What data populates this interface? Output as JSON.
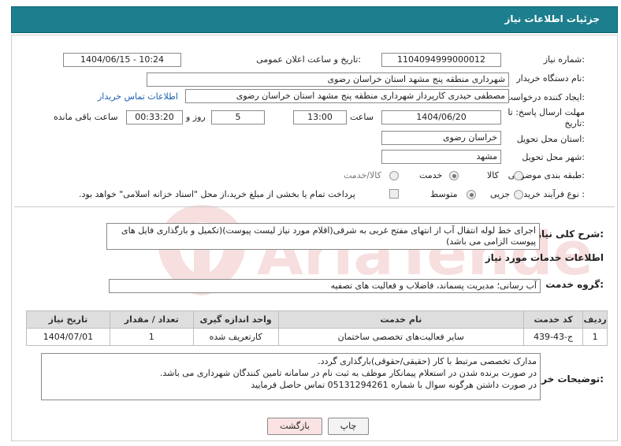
{
  "header": {
    "title": "جزئیات اطلاعات نیاز"
  },
  "form": {
    "need_number": {
      "label": "شماره نیاز:",
      "value": "1104094999000012"
    },
    "announce_datetime": {
      "label": "تاریخ و ساعت اعلان عمومی:",
      "value": "1404/06/15 - 10:24"
    },
    "buyer_org": {
      "label": "نام دستگاه خریدار:",
      "value": "شهرداری منطقه پنج مشهد استان خراسان رضوی"
    },
    "requester": {
      "label": "ایجاد کننده درخواست:",
      "value": "مصطفی حیدری کارپرداز شهرداری منطقه پنج مشهد استان خراسان رضوی",
      "contact_link": "اطلاعات تماس خریدار"
    },
    "deadline": {
      "label_line1": "مهلت ارسال پاسخ: تا",
      "label_line2": "تاریخ:",
      "date": "1404/06/20",
      "time_label": "ساعت",
      "time": "13:00",
      "days": "5",
      "days_label": "روز و",
      "remaining": "00:33:20",
      "remaining_label": "ساعت باقی مانده"
    },
    "province": {
      "label": "استان محل تحویل:",
      "value": "خراسان رضوی"
    },
    "city": {
      "label": "شهر محل تحویل:",
      "value": "مشهد"
    },
    "category": {
      "label": "طبقه بندی موضوعی:",
      "options": [
        "کالا",
        "خدمت",
        "کالا/خدمت"
      ],
      "selected": "خدمت"
    },
    "process": {
      "label": "نوع فرآیند خرید :",
      "options": [
        "جزیی",
        "متوسط"
      ],
      "selected": "متوسط",
      "payment_note": "پرداخت تمام یا بخشی از مبلغ خرید،از محل \"اسناد خزانه اسلامی\" خواهد بود."
    }
  },
  "summary": {
    "label": "شرح کلی نیاز:",
    "text": "اجرای خط لوله انتقال آب از انتهای مفتح غربی به شرقی(اقلام مورد نیاز لیست پیوست)(تکمیل و بارگذاری فایل های پیوست الزامی می باشد)"
  },
  "services": {
    "title": "اطلاعات خدمات مورد نیاز",
    "group_label": "گروه خدمت:",
    "group_value": "آب رسانی؛ مدیریت پسماند، فاضلاب و فعالیت های تصفیه",
    "table": {
      "headers": [
        "ردیف",
        "کد خدمت",
        "نام خدمت",
        "واحد اندازه گیری",
        "تعداد / مقدار",
        "تاریخ نیاز"
      ],
      "rows": [
        [
          "1",
          "ج-43-439",
          "سایر فعالیت‌های تخصصی ساختمان",
          "کارتعریف شده",
          "1",
          "1404/07/01"
        ]
      ]
    }
  },
  "buyer_notes": {
    "label": "توضیحات خریدار:",
    "lines": [
      "مدارک تخصصی مرتبط با کار (حقیقی/حقوقی)بارگذاری گردد.",
      "در صورت برنده شدن در استعلام پیمانکار موظف به ثبت نام در سامانه تامین کنندگان شهرداری می باشد.",
      "در صورت داشتن هرگونه سوال  با شماره 05131294261 تماس حاصل فرمایید"
    ]
  },
  "buttons": {
    "print": "چاپ",
    "back": "بازگشت"
  },
  "watermark": {
    "text": "AriaTender.neT"
  },
  "colors": {
    "header_bg": "#1d7e8d",
    "link": "#1a5fb4",
    "back_button_bg": "#fbe3e3"
  }
}
